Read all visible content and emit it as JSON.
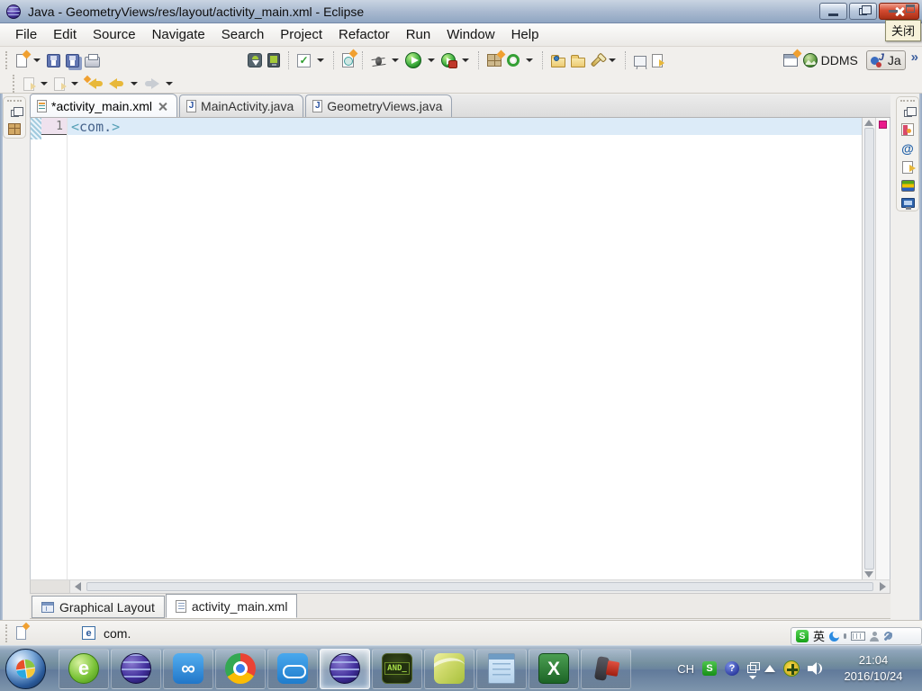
{
  "colors": {
    "close_red": "#c0392b",
    "titlebar_blue": "#a7b8cf",
    "taskbar_blue": "#75909f",
    "current_line": "#dcebf8",
    "error_marker_magenta": "#ea1a8c",
    "run_green": "#2f9e2f",
    "android_green": "#a4ca39"
  },
  "window": {
    "title": "Java - GeometryViews/res/layout/activity_main.xml - Eclipse",
    "close_tooltip": "关闭"
  },
  "menu": {
    "items": [
      "File",
      "Edit",
      "Source",
      "Navigate",
      "Search",
      "Project",
      "Refactor",
      "Run",
      "Window",
      "Help"
    ]
  },
  "glyphs": {
    "check": "✓",
    "java_j": "J",
    "javadoc_at": "@",
    "overflow": "»",
    "browser_e": "e",
    "baidu": "∞",
    "android": "AND_",
    "excel_x": "X"
  },
  "perspectives": {
    "ddms_label": "DDMS",
    "java_label": "Ja"
  },
  "editor": {
    "tabs": [
      {
        "label": "*activity_main.xml",
        "dirty": true,
        "active": true
      },
      {
        "label": "MainActivity.java",
        "dirty": false,
        "active": false
      },
      {
        "label": "GeometryViews.java",
        "dirty": false,
        "active": false
      }
    ],
    "line_number": "1",
    "code": {
      "open": "<",
      "tag": "com.",
      "close": ">"
    }
  },
  "page_tabs": {
    "items": [
      "Graphical Layout",
      "activity_main.xml"
    ],
    "active": "activity_main.xml"
  },
  "statusbar": {
    "badge": "e",
    "text": "com."
  },
  "sogou": {
    "s": "S",
    "mode": "英"
  },
  "taskbar": {
    "tray_lang": "CH",
    "tray_s": "S",
    "tray_help": "?",
    "time": "21:04",
    "date": "2016/10/24"
  }
}
